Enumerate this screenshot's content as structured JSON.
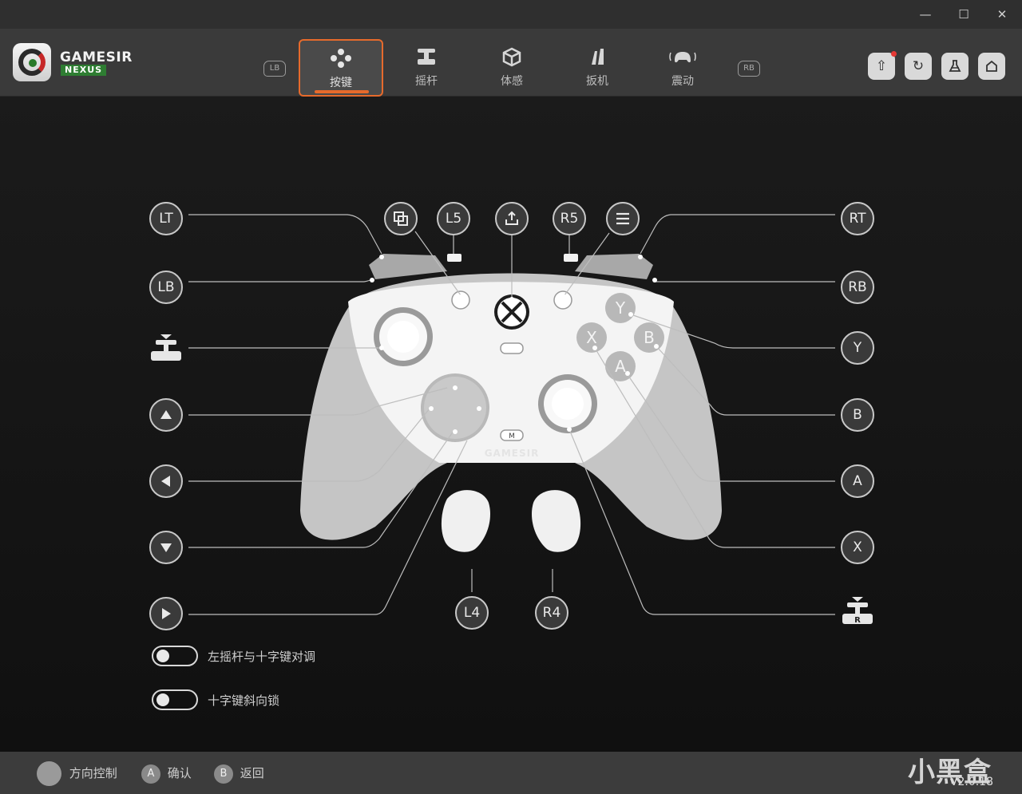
{
  "window": {
    "minimize": "—",
    "maximize": "☐",
    "close": "✕"
  },
  "brand": {
    "name": "GAMESIR",
    "sub": "NEXUS"
  },
  "tabs": {
    "lb": "LB",
    "rb": "RB",
    "items": [
      {
        "label": "按键",
        "icon": "buttons-icon",
        "active": true
      },
      {
        "label": "摇杆",
        "icon": "joystick-icon"
      },
      {
        "label": "体感",
        "icon": "motion-cube-icon"
      },
      {
        "label": "扳机",
        "icon": "trigger-icon"
      },
      {
        "label": "震动",
        "icon": "vibration-icon"
      }
    ]
  },
  "header_buttons": [
    "firmware-upgrade-icon",
    "reset-icon",
    "lab-flask-icon",
    "home-icon"
  ],
  "accent_color": "#e66a2c",
  "mapping": {
    "top_row": [
      "L5",
      "R5"
    ],
    "left": {
      "lt": "LT",
      "lb": "LB"
    },
    "right": {
      "rt": "RT",
      "rb": "RB",
      "y": "Y",
      "b": "B",
      "a": "A",
      "x": "X"
    },
    "back": {
      "l4": "L4",
      "r4": "R4"
    },
    "controller": {
      "face_y": "Y",
      "face_b": "B",
      "face_x": "X",
      "face_a": "A",
      "m": "M",
      "logo": "GAMESIR"
    },
    "right_stick_label": "R"
  },
  "toggles": [
    {
      "label": "左摇杆与十字键对调",
      "on": false
    },
    {
      "label": "十字键斜向锁",
      "on": false
    }
  ],
  "footer": {
    "hints": [
      {
        "icon": "stick-icon",
        "key": "",
        "label": "方向控制"
      },
      {
        "icon": "a-button-icon",
        "key": "A",
        "label": "确认"
      },
      {
        "icon": "b-button-icon",
        "key": "B",
        "label": "返回"
      }
    ],
    "watermark": "小黑盒",
    "version": "V2.0.18"
  }
}
